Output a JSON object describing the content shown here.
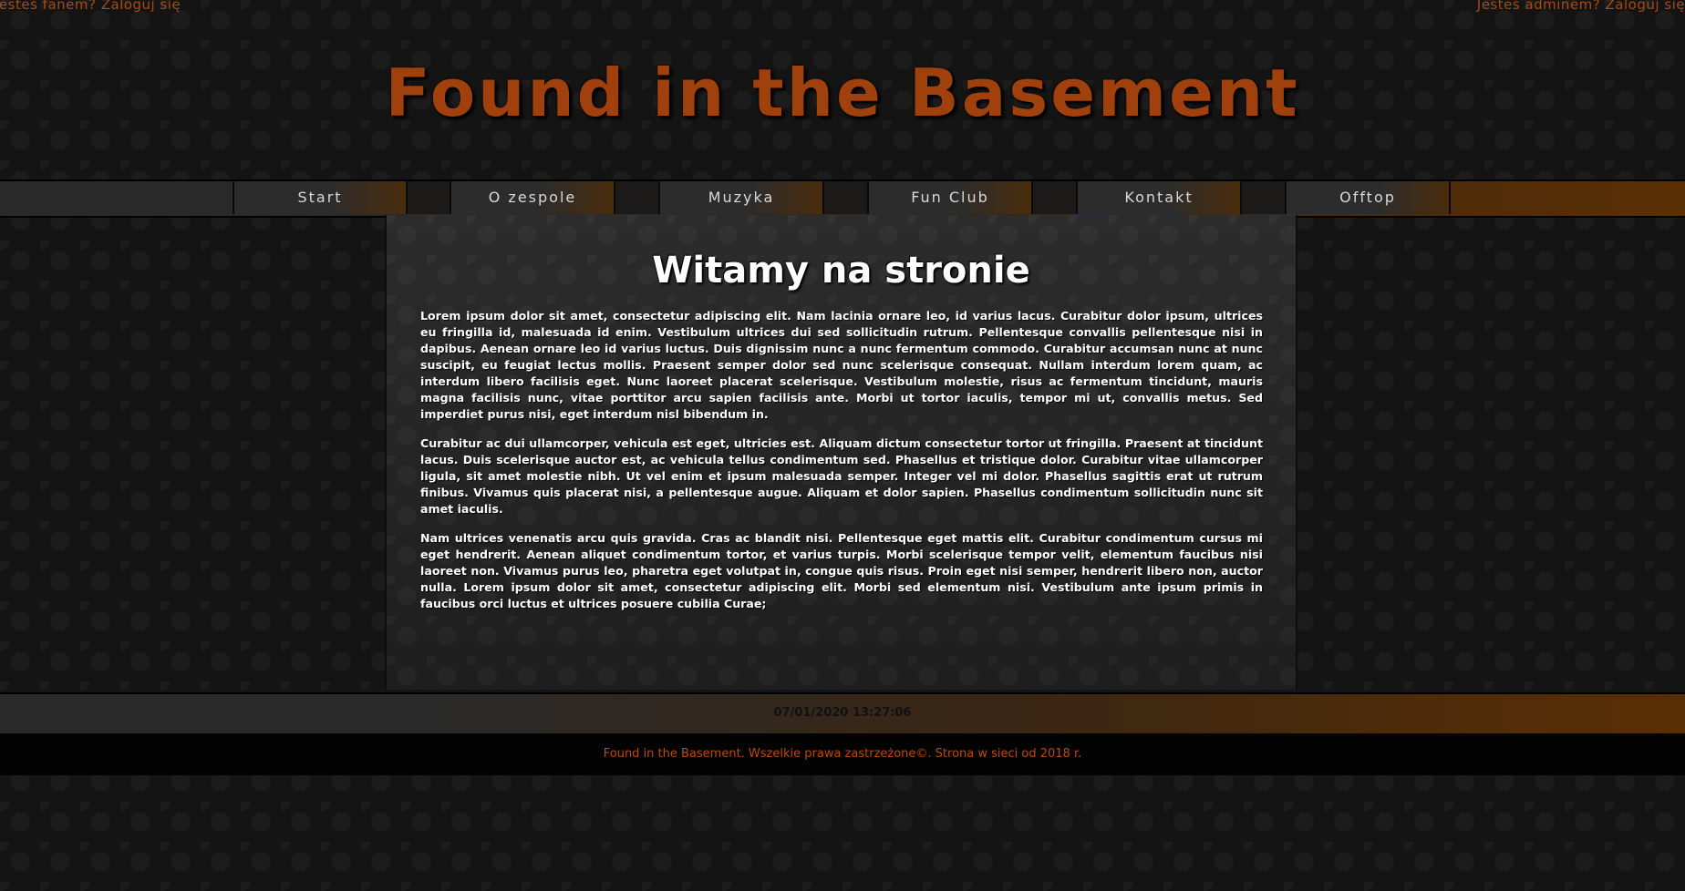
{
  "top_links": {
    "fan_login": "Jesteś fanem? Zaloguj się",
    "admin_login": "Jesteś adminem? Zaloguj się"
  },
  "site_title": "Found in the Basement",
  "nav": {
    "items": [
      {
        "label": "Start"
      },
      {
        "label": "O zespole"
      },
      {
        "label": "Muzyka"
      },
      {
        "label": "Fun Club"
      },
      {
        "label": "Kontakt"
      },
      {
        "label": "Offtop"
      }
    ]
  },
  "content": {
    "heading": "Witamy na stronie",
    "paragraphs": [
      "Lorem ipsum dolor sit amet, consectetur adipiscing elit. Nam lacinia ornare leo, id varius lacus. Curabitur dolor ipsum, ultrices eu fringilla id, malesuada id enim. Vestibulum ultrices dui sed sollicitudin rutrum. Pellentesque convallis pellentesque nisi in dapibus. Aenean ornare leo id varius luctus. Duis dignissim nunc a nunc fermentum commodo. Curabitur accumsan nunc at nunc suscipit, eu feugiat lectus mollis. Praesent semper dolor sed nunc scelerisque consequat. Nullam interdum lorem quam, ac interdum libero facilisis eget. Nunc laoreet placerat scelerisque. Vestibulum molestie, risus ac fermentum tincidunt, mauris magna facilisis nunc, vitae porttitor arcu sapien facilisis ante. Morbi ut tortor iaculis, tempor mi ut, convallis metus. Sed imperdiet purus nisi, eget interdum nisl bibendum in.",
      "Curabitur ac dui ullamcorper, vehicula est eget, ultricies est. Aliquam dictum consectetur tortor ut fringilla. Praesent at tincidunt lacus. Duis scelerisque auctor est, ac vehicula tellus condimentum sed. Phasellus et tristique dolor. Curabitur vitae ullamcorper ligula, sit amet molestie nibh. Ut vel enim et ipsum malesuada semper. Integer vel mi dolor. Phasellus sagittis erat ut rutrum finibus. Vivamus quis placerat nisi, a pellentesque augue. Aliquam et dolor sapien. Phasellus condimentum sollicitudin nunc sit amet iaculis.",
      "Nam ultrices venenatis arcu quis gravida. Cras ac blandit nisi. Pellentesque eget mattis elit. Curabitur condimentum cursus mi eget hendrerit. Aenean aliquet condimentum tortor, et varius turpis. Morbi scelerisque tempor velit, elementum faucibus nisi laoreet non. Vivamus purus leo, pharetra eget volutpat in, congue quis risus. Proin eget nisi semper, hendrerit libero non, auctor nulla. Lorem ipsum dolor sit amet, consectetur adipiscing elit. Morbi sed elementum nisi. Vestibulum ante ipsum primis in faucibus orci luctus et ultrices posuere cubilia Curae;"
    ]
  },
  "datetime": "07/01/2020 13:27:06",
  "footer": {
    "text": "Found in the Basement. Wszelkie prawa zastrzeżone©. Strona w sieci od 2018 r."
  },
  "colors": {
    "accent": "#a0400c",
    "nav_gradient_end": "#5a2f04",
    "background": "#141414"
  }
}
